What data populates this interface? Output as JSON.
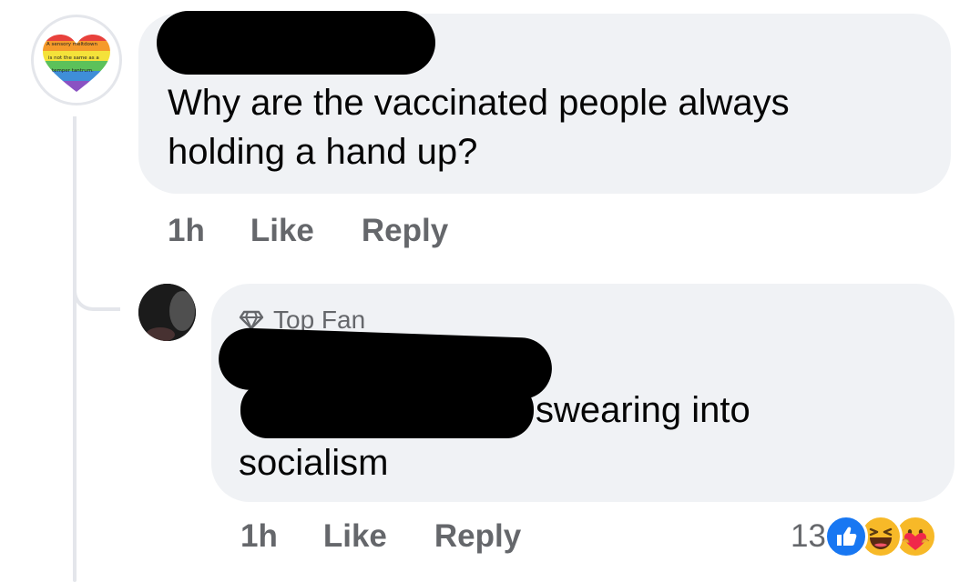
{
  "comment": {
    "text": "Why are the vaccinated people always holding a hand up?",
    "time": "1h",
    "like_label": "Like",
    "reply_label": "Reply",
    "avatar_text": "A sensory meltdown is not the same as a temper tantrum."
  },
  "reply": {
    "badge": "Top Fan",
    "text_visible": "swearing into",
    "text_line2": "socialism",
    "time": "1h",
    "like_label": "Like",
    "reply_label": "Reply",
    "reaction_count": "13",
    "reactions": [
      "like-reaction-icon",
      "haha-reaction-icon",
      "care-reaction-icon"
    ]
  },
  "colors": {
    "bubble": "#f0f2f5",
    "secondary_text": "#65676b",
    "like_blue": "#1877f2",
    "reaction_yellow": "#f7b928"
  }
}
